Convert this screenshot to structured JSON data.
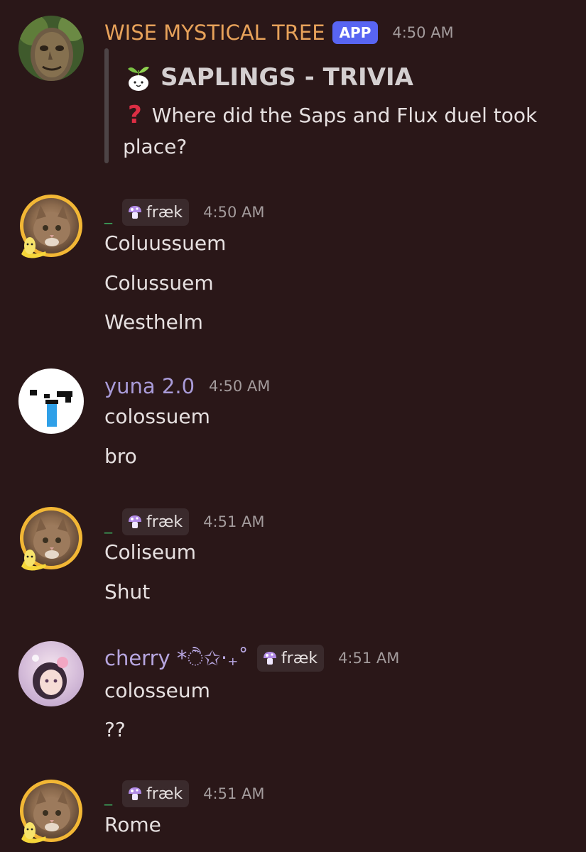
{
  "messages": [
    {
      "author": "WISE MYSTICAL TREE",
      "app_badge": "APP",
      "time": "4:50 AM",
      "embed": {
        "title": "SAPLINGS - TRIVIA",
        "line1": "Where did the Saps and Flux duel took",
        "line2": "place?"
      }
    },
    {
      "author": "_",
      "tag": "fræk",
      "time": "4:50 AM",
      "lines": [
        "Coluussuem",
        "Colussuem",
        "Westhelm"
      ]
    },
    {
      "author": "yuna 2.0",
      "time": "4:50 AM",
      "lines": [
        "colossuem",
        "bro"
      ]
    },
    {
      "author": "_",
      "tag": "fræk",
      "time": "4:51 AM",
      "lines": [
        "Coliseum",
        "Shut"
      ]
    },
    {
      "author": "cherry *ੈ✩‧₊˚",
      "tag": "fræk",
      "time": "4:51 AM",
      "lines": [
        "colosseum",
        "??"
      ]
    },
    {
      "author": "_",
      "tag": "fræk",
      "time": "4:51 AM",
      "lines": [
        "Rome"
      ]
    }
  ],
  "colors": {
    "background": "#2a1718",
    "tree_name": "#e7a25a",
    "underscore_name": "#3ba55c",
    "yuna_name": "#a99bd8",
    "cherry_name": "#b7a6e0",
    "app_badge": "#5865f2"
  }
}
